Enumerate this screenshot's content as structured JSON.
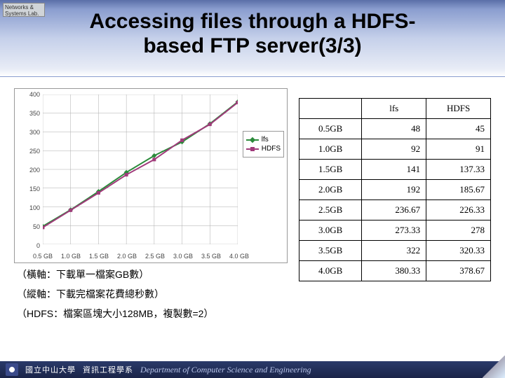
{
  "lab_badge": "Networks &\nSystems Lab.",
  "title_line1": "Accessing files through a HDFS-",
  "title_line2": "based FTP server(3/3)",
  "chart_data": {
    "type": "line",
    "categories": [
      "0.5 GB",
      "1.0 GB",
      "1.5 GB",
      "2.0 GB",
      "2.5 GB",
      "3.0 GB",
      "3.5 GB",
      "4.0 GB"
    ],
    "series": [
      {
        "name": "lfs",
        "color": "#2a8a3a",
        "values": [
          48,
          92,
          141,
          192,
          236.67,
          273.33,
          322,
          380.33
        ]
      },
      {
        "name": "HDFS",
        "color": "#a03a7a",
        "values": [
          45,
          91,
          137.33,
          185.67,
          226.33,
          278,
          320.33,
          378.67
        ]
      }
    ],
    "ylim": [
      0,
      400
    ],
    "yticks": [
      0,
      50,
      100,
      150,
      200,
      250,
      300,
      350,
      400
    ],
    "xlabel": "",
    "ylabel": ""
  },
  "table": {
    "headers": [
      "",
      "lfs",
      "HDFS"
    ],
    "rows": [
      [
        "0.5GB",
        "48",
        "45"
      ],
      [
        "1.0GB",
        "92",
        "91"
      ],
      [
        "1.5GB",
        "141",
        "137.33"
      ],
      [
        "2.0GB",
        "192",
        "185.67"
      ],
      [
        "2.5GB",
        "236.67",
        "226.33"
      ],
      [
        "3.0GB",
        "273.33",
        "278"
      ],
      [
        "3.5GB",
        "322",
        "320.33"
      ],
      [
        "4.0GB",
        "380.33",
        "378.67"
      ]
    ]
  },
  "notes": {
    "n1": "（橫軸：下載單一檔案GB數）",
    "n2": "（縱軸：下載完檔案花費總秒數）",
    "n3": "（HDFS：檔案區塊大小128MB，複製數=2）"
  },
  "footer": {
    "univ": "國立中山大學",
    "dept_cn": "資訊工程學系",
    "dept_en": "Department of Computer Science and Engineering"
  }
}
